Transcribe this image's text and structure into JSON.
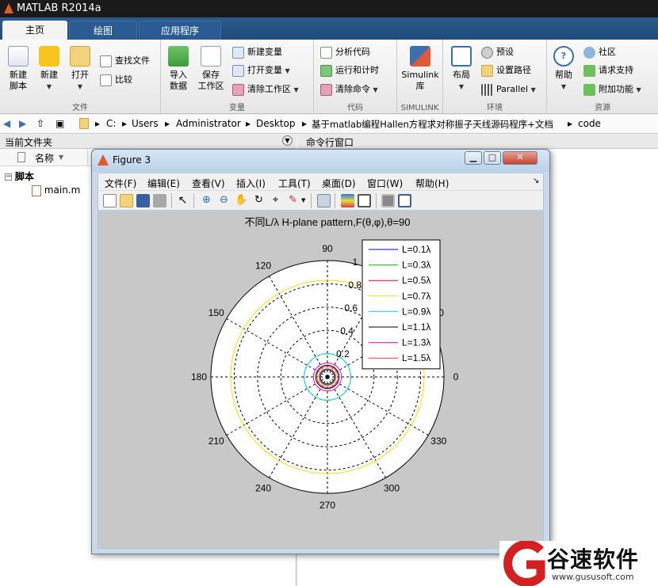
{
  "app": {
    "title": "MATLAB R2014a"
  },
  "ribbon": {
    "tabs": [
      {
        "label": "主页"
      },
      {
        "label": "绘图"
      },
      {
        "label": "应用程序"
      }
    ],
    "groups": {
      "file": {
        "label": "文件",
        "new_script": "新建\n脚本",
        "new": "新建",
        "open": "打开",
        "find_files": "查找文件",
        "compare": "比较"
      },
      "variable": {
        "label": "变量",
        "import": "导入\n数据",
        "save_ws": "保存\n工作区",
        "new_var": "新建变量",
        "open_var": "打开变量",
        "clear_ws": "清除工作区"
      },
      "code": {
        "label": "代码",
        "analyze": "分析代码",
        "run_time": "运行和计时",
        "clear_cmd": "清除命令"
      },
      "simulink": {
        "label": "SIMULINK",
        "lib": "Simulink\n库"
      },
      "env": {
        "label": "环境",
        "layout": "布局",
        "prefs": "预设",
        "set_path": "设置路径",
        "parallel": "Parallel"
      },
      "resources": {
        "label": "资源",
        "help": "帮助",
        "community": "社区",
        "request": "请求支持",
        "addons": "附加功能"
      }
    }
  },
  "path": {
    "segments": [
      "C:",
      "Users",
      "Administrator",
      "Desktop",
      "基于matlab编程Hallen方程求对称振子天线源码程序+文档",
      "code"
    ]
  },
  "current_folder": {
    "title": "当前文件夹",
    "col_name": "名称",
    "sort_arrow": "▼",
    "tree": {
      "folder": "脚本",
      "file": "main.m"
    }
  },
  "command_window": {
    "title": "命令行窗口"
  },
  "figure": {
    "title": "Figure 3",
    "menu": [
      "文件(F)",
      "编辑(E)",
      "查看(V)",
      "插入(I)",
      "工具(T)",
      "桌面(D)",
      "窗口(W)",
      "帮助(H)"
    ],
    "menu_arrow": "↘"
  },
  "chart_data": {
    "type": "polar",
    "title": "不同L/λ H-plane pattern,F(θ,φ),θ=90",
    "angle_ticks": [
      "90",
      "120",
      "150",
      "180",
      "210",
      "240",
      "270",
      "300",
      "330",
      "0",
      "30",
      "60"
    ],
    "radial_ticks": [
      "0.2",
      "0.4",
      "0.6",
      "0.8",
      "1"
    ],
    "rlim": [
      0,
      1
    ],
    "grid": true,
    "legend_position": "top-right",
    "series": [
      {
        "name": "L=0.1λ",
        "color": "#0000ff",
        "r": 0.06
      },
      {
        "name": "L=0.3λ",
        "color": "#00cc00",
        "r": 0.065
      },
      {
        "name": "L=0.5λ",
        "color": "#ff0000",
        "r": 0.07
      },
      {
        "name": "L=0.7λ",
        "color": "#ffdd00",
        "r": 0.83
      },
      {
        "name": "L=0.9λ",
        "color": "#00e5ee",
        "r": 0.2
      },
      {
        "name": "L=1.1λ",
        "color": "#000000",
        "r": 0.1
      },
      {
        "name": "L=1.3λ",
        "color": "#ff00ff",
        "r": 0.12
      },
      {
        "name": "L=1.5λ",
        "color": "#ff3333",
        "r": 0.09
      }
    ]
  },
  "watermark": {
    "brand": "谷速软件",
    "url": "www.gususoft.com"
  }
}
